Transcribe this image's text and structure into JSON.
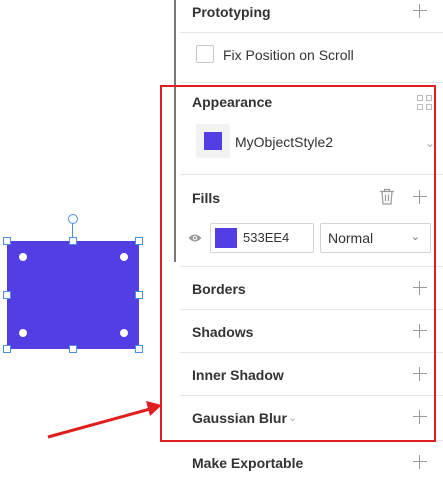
{
  "canvas": {
    "shape_color": "#533ee4",
    "handle_color": "#4a8fe0"
  },
  "panel": {
    "prototyping": {
      "title": "Prototyping",
      "fix_position_label": "Fix Position on Scroll",
      "fix_position_checked": false
    },
    "appearance": {
      "title": "Appearance",
      "style_name": "MyObjectStyle2",
      "style_color": "#533ee4"
    },
    "fills": {
      "title": "Fills",
      "hex_value": "533EE4",
      "blend_mode": "Normal",
      "visible": true
    },
    "borders": {
      "title": "Borders"
    },
    "shadows": {
      "title": "Shadows"
    },
    "inner_shadow": {
      "title": "Inner Shadow"
    },
    "gaussian_blur": {
      "title": "Gaussian Blur"
    },
    "make_exportable": {
      "title": "Make Exportable"
    }
  },
  "annotation": {
    "highlight_color": "#e02020"
  }
}
